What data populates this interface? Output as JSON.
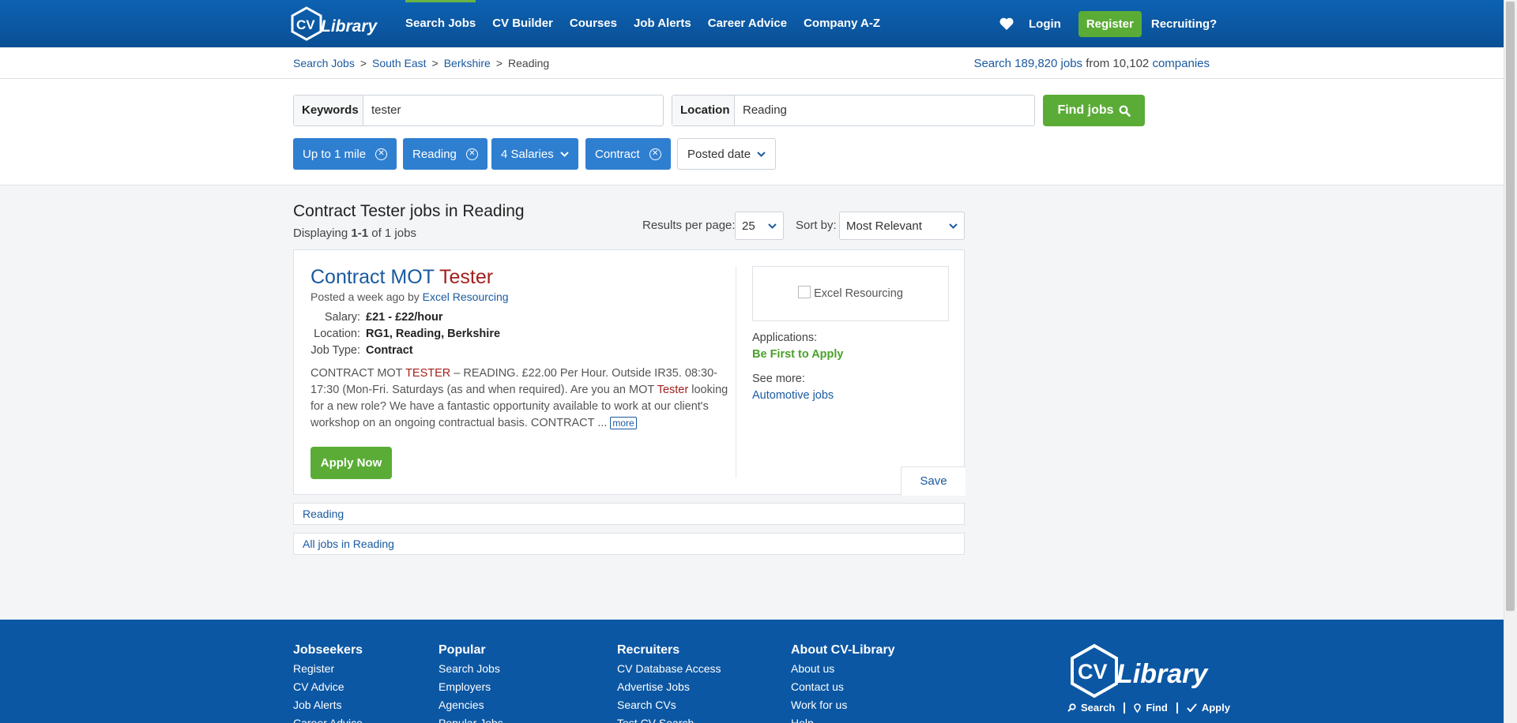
{
  "header": {
    "logo_text": "CV Library",
    "nav": [
      {
        "label": "Search Jobs",
        "active": true
      },
      {
        "label": "CV Builder"
      },
      {
        "label": "Courses"
      },
      {
        "label": "Job Alerts"
      },
      {
        "label": "Career Advice"
      },
      {
        "label": "Company A-Z"
      }
    ],
    "login": "Login",
    "register": "Register",
    "recruiting": "Recruiting?"
  },
  "breadcrumb": {
    "items": [
      "Search Jobs",
      "South East",
      "Berkshire",
      "Reading"
    ],
    "separator": ">"
  },
  "stats": {
    "prefix": "Search",
    "jobs_count": "189,820 jobs",
    "middle": "from",
    "companies_count": "10,102",
    "companies_label": "companies"
  },
  "search": {
    "keywords_label": "Keywords",
    "keywords_value": "tester",
    "location_label": "Location",
    "location_value": "Reading",
    "find_button": "Find jobs"
  },
  "filters": [
    {
      "label": "Up to 1 mile",
      "kind": "remove"
    },
    {
      "label": "Reading",
      "kind": "remove"
    },
    {
      "label": "4 Salaries",
      "kind": "dropdown"
    },
    {
      "label": "Contract",
      "kind": "remove"
    },
    {
      "label": "Posted date",
      "kind": "dropdown-plain"
    }
  ],
  "results": {
    "title": "Contract Tester jobs in Reading",
    "displaying_prefix": "Displaying",
    "displaying_range": "1-1",
    "displaying_suffix": "of 1 jobs",
    "per_page_label": "Results per page:",
    "per_page_value": "25",
    "sort_label": "Sort by:",
    "sort_value": "Most Relevant"
  },
  "job": {
    "title_prefix": "Contract MOT",
    "title_highlight": "Tester",
    "posted_prefix": "Posted a week ago by",
    "company": "Excel Resourcing",
    "facts": [
      {
        "key": "Salary:",
        "value": "£21 - £22/hour"
      },
      {
        "key": "Location:",
        "value": "RG1, Reading, Berkshire"
      },
      {
        "key": "Job Type:",
        "value": "Contract"
      }
    ],
    "desc_1": "CONTRACT MOT",
    "desc_hl_1": "TESTER",
    "desc_2": "– READING. £22.00 Per Hour. Outside IR35. 08:30-17:30 (Mon-Fri. Saturdays (as and when required). Are you an MOT",
    "desc_hl_2": "Tester",
    "desc_3": "looking for a new role? We have a fantastic opportunity available to work at our client's workshop on an ongoing contractual basis. CONTRACT ...",
    "more": "more",
    "apply": "Apply Now",
    "logo_alt": "Excel Resourcing",
    "applications_label": "Applications:",
    "applications_value": "Be First to Apply",
    "see_more_label": "See more:",
    "see_more_link": "Automotive jobs",
    "save": "Save"
  },
  "related_links": [
    "Reading",
    "All jobs in Reading"
  ],
  "footer": {
    "columns": [
      {
        "heading": "Jobseekers",
        "links": [
          "Register",
          "CV Advice",
          "Job Alerts",
          "Career Advice"
        ]
      },
      {
        "heading": "Popular",
        "links": [
          "Search Jobs",
          "Employers",
          "Agencies",
          "Popular Jobs"
        ]
      },
      {
        "heading": "Recruiters",
        "links": [
          "CV Database Access",
          "Advertise Jobs",
          "Search CVs",
          "Test CV Search"
        ]
      },
      {
        "heading": "About CV-Library",
        "links": [
          "About us",
          "Contact us",
          "Work for us",
          "Help"
        ]
      }
    ],
    "tagline": [
      "Search",
      "Find",
      "Apply"
    ]
  },
  "colors": {
    "header_blue": "#0b57a4",
    "brand_green": "#5aac36",
    "chip_blue": "#2f7fd1",
    "link_blue": "#1a5aa0",
    "highlight_red": "#a3201c"
  }
}
